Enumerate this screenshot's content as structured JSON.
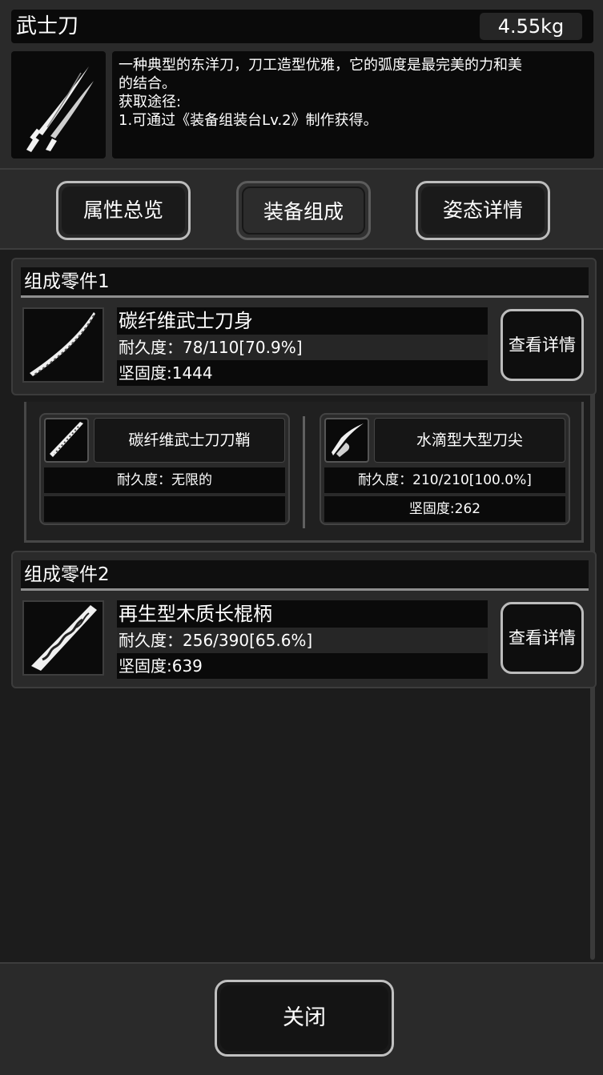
{
  "item": {
    "name": "武士刀",
    "weight": "4.55kg",
    "description_lines": [
      "一种典型的东洋刀，刀工造型优雅，它的弧度是最完美的力和美",
      "的结合。",
      "获取途径:",
      "1.可通过《装备组装台Lv.2》制作获得。"
    ]
  },
  "tabs": [
    {
      "label": "属性总览"
    },
    {
      "label": "装备组成"
    },
    {
      "label": "姿态详情"
    }
  ],
  "parts": [
    {
      "header": "组成零件1",
      "name": "碳纤维武士刀身",
      "durability": "耐久度：78/110[70.9%]",
      "hardness": "坚固度:1444",
      "detail_label": "查看详情"
    },
    {
      "header": "组成零件2",
      "name": "再生型木质长棍柄",
      "durability": "耐久度：256/390[65.6%]",
      "hardness": "坚固度:639",
      "detail_label": "查看详情"
    }
  ],
  "subparts": [
    {
      "name": "碳纤维武士刀刀鞘",
      "durability": "耐久度：无限的",
      "hardness": ""
    },
    {
      "name": "水滴型大型刀尖",
      "durability": "耐久度：210/210[100.0%]",
      "hardness": "坚固度:262"
    }
  ],
  "footer": {
    "close_label": "关闭"
  }
}
